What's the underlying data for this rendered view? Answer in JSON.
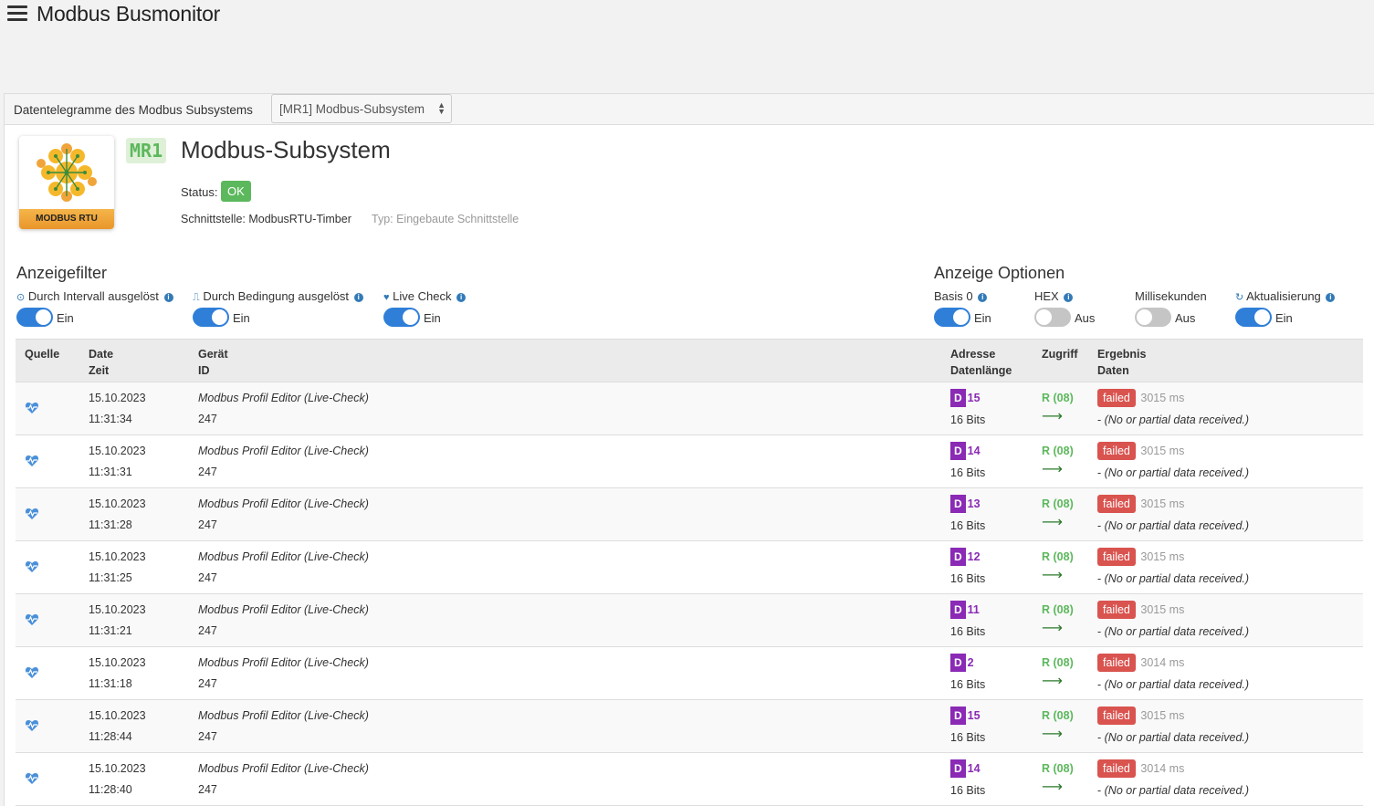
{
  "app": {
    "title": "Modbus Busmonitor"
  },
  "panel": {
    "header_title": "Datentelegramme des Modbus Subsystems",
    "subsystem_select": "[MR1] Modbus-Subsystem"
  },
  "subsystem": {
    "logo_label": "MODBUS RTU",
    "badge": "MR1",
    "title": "Modbus-Subsystem",
    "status_label": "Status:",
    "status_value": "OK",
    "interface": "Schnittstelle: ModbusRTU-Timber",
    "interface_type": "Typ: Eingebaute Schnittstelle"
  },
  "filters": {
    "title": "Anzeigefilter",
    "items": [
      {
        "label": "Durch Intervall ausgelöst",
        "state": "Ein",
        "on": true
      },
      {
        "label": "Durch Bedingung ausgelöst",
        "state": "Ein",
        "on": true
      },
      {
        "label": "Live Check",
        "state": "Ein",
        "on": true
      }
    ]
  },
  "options": {
    "title": "Anzeige Optionen",
    "items": [
      {
        "label": "Basis 0",
        "state": "Ein",
        "on": true
      },
      {
        "label": "HEX",
        "state": "Aus",
        "on": false
      },
      {
        "label": "Millisekunden",
        "state": "Aus",
        "on": false
      },
      {
        "label": "Aktualisierung",
        "state": "Ein",
        "on": true
      }
    ]
  },
  "table": {
    "headers": {
      "source": "Quelle",
      "date": "Date",
      "time": "Zeit",
      "device": "Gerät",
      "id": "ID",
      "address": "Adresse",
      "length": "Datenlänge",
      "access": "Zugriff",
      "result": "Ergebnis",
      "data": "Daten"
    },
    "rows": [
      {
        "date": "15.10.2023",
        "time": "11:31:34",
        "device": "Modbus Profil Editor (Live-Check)",
        "id": "247",
        "dtype": "D",
        "addr": "15",
        "len": "16 Bits",
        "access": "R (08)",
        "result": "failed",
        "ms": "3015 ms",
        "data_prefix": "- ",
        "data": "(No or partial data received.)"
      },
      {
        "date": "15.10.2023",
        "time": "11:31:31",
        "device": "Modbus Profil Editor (Live-Check)",
        "id": "247",
        "dtype": "D",
        "addr": "14",
        "len": "16 Bits",
        "access": "R (08)",
        "result": "failed",
        "ms": "3015 ms",
        "data_prefix": "- ",
        "data": "(No or partial data received.)"
      },
      {
        "date": "15.10.2023",
        "time": "11:31:28",
        "device": "Modbus Profil Editor (Live-Check)",
        "id": "247",
        "dtype": "D",
        "addr": "13",
        "len": "16 Bits",
        "access": "R (08)",
        "result": "failed",
        "ms": "3015 ms",
        "data_prefix": "- ",
        "data": "(No or partial data received.)"
      },
      {
        "date": "15.10.2023",
        "time": "11:31:25",
        "device": "Modbus Profil Editor (Live-Check)",
        "id": "247",
        "dtype": "D",
        "addr": "12",
        "len": "16 Bits",
        "access": "R (08)",
        "result": "failed",
        "ms": "3015 ms",
        "data_prefix": "- ",
        "data": "(No or partial data received.)"
      },
      {
        "date": "15.10.2023",
        "time": "11:31:21",
        "device": "Modbus Profil Editor (Live-Check)",
        "id": "247",
        "dtype": "D",
        "addr": "11",
        "len": "16 Bits",
        "access": "R (08)",
        "result": "failed",
        "ms": "3015 ms",
        "data_prefix": "- ",
        "data": "(No or partial data received.)"
      },
      {
        "date": "15.10.2023",
        "time": "11:31:18",
        "device": "Modbus Profil Editor (Live-Check)",
        "id": "247",
        "dtype": "D",
        "addr": "2",
        "len": "16 Bits",
        "access": "R (08)",
        "result": "failed",
        "ms": "3014 ms",
        "data_prefix": "- ",
        "data": "(No or partial data received.)"
      },
      {
        "date": "15.10.2023",
        "time": "11:28:44",
        "device": "Modbus Profil Editor (Live-Check)",
        "id": "247",
        "dtype": "D",
        "addr": "15",
        "len": "16 Bits",
        "access": "R (08)",
        "result": "failed",
        "ms": "3015 ms",
        "data_prefix": "- ",
        "data": "(No or partial data received.)"
      },
      {
        "date": "15.10.2023",
        "time": "11:28:40",
        "device": "Modbus Profil Editor (Live-Check)",
        "id": "247",
        "dtype": "D",
        "addr": "14",
        "len": "16 Bits",
        "access": "R (08)",
        "result": "failed",
        "ms": "3014 ms",
        "data_prefix": "- ",
        "data": "(No or partial data received.)"
      }
    ]
  },
  "colors": {
    "accent": "#2f7fd9",
    "ok": "#5cb85c",
    "failed": "#d9534f",
    "address": "#8a2ab5"
  }
}
